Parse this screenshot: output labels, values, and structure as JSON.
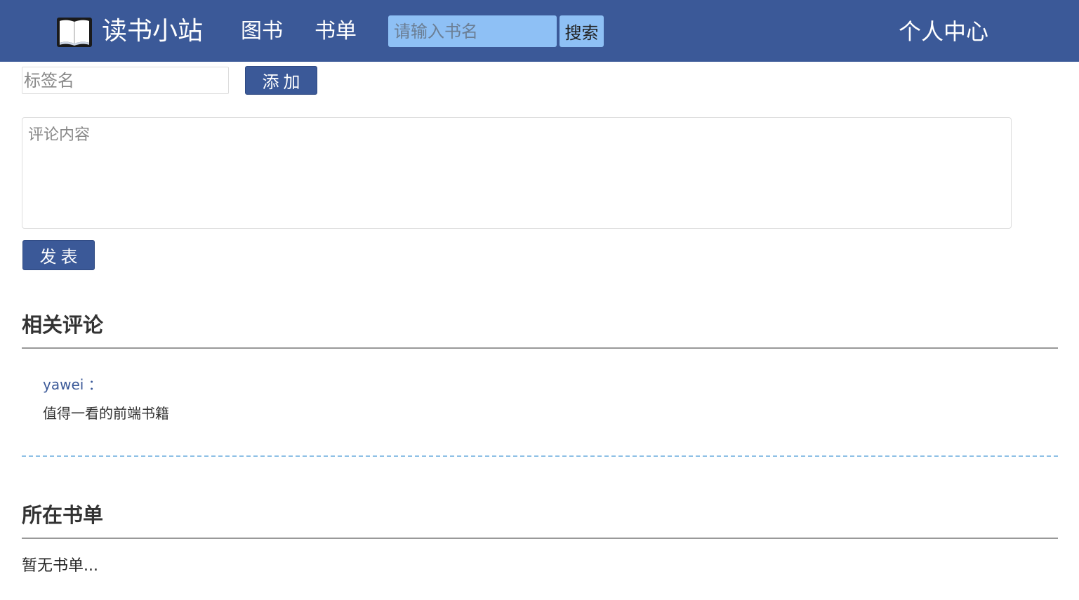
{
  "header": {
    "site_name": "读书小站",
    "logo_icon": "open-book-icon",
    "nav": {
      "books": "图书",
      "lists": "书单"
    },
    "search": {
      "placeholder": "请输入书名",
      "value": "",
      "button_label": "搜索"
    },
    "personal_center": "个人中心"
  },
  "tag_form": {
    "placeholder": "标签名",
    "value": "",
    "add_label": "添加"
  },
  "comment_form": {
    "placeholder": "评论内容",
    "value": "",
    "publish_label": "发表"
  },
  "comments_section": {
    "title": "相关评论",
    "items": [
      {
        "author": "yawei ：",
        "text": "值得一看的前端书籍"
      }
    ]
  },
  "lists_section": {
    "title": "所在书单",
    "empty_text": "暂无书单..."
  },
  "colors": {
    "header_bg": "#3b5998",
    "search_bg": "#8ec0f5",
    "primary_button": "#3b5998",
    "author_link": "#3b5998",
    "divider_dashed": "#8ec0e6"
  }
}
